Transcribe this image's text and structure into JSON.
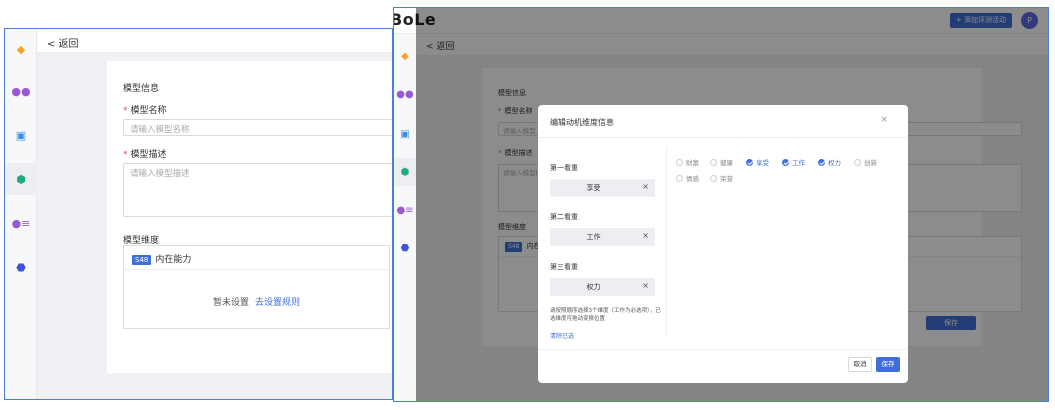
{
  "left": {
    "back_label": "< 返回",
    "section_info": "模型信息",
    "name_label": "模型名称",
    "name_placeholder": "请输入模型名称",
    "desc_label": "模型描述",
    "desc_placeholder": "请输入模型描述",
    "section_dimension": "模型维度",
    "dimension_badge": "S48",
    "dimension_name": "内在能力",
    "empty_text": "暂未设置",
    "set_rule_link": "去设置规则"
  },
  "right": {
    "logo": "BoLe",
    "add_button": "+ 添加评测活动",
    "avatar_letter": "P",
    "back_label": "< 返回",
    "section_info": "模型信息",
    "name_label": "模型名称",
    "name_placeholder": "请输入模型",
    "desc_label": "模型描述",
    "desc_placeholder": "请输入模型描",
    "section_dimension": "模型维度",
    "dimension_badge": "S48",
    "dimension_name": "内在",
    "save_bg_button": "保存"
  },
  "modal": {
    "title": "编辑动机维度信息",
    "close": "×",
    "priorities": [
      {
        "label": "第一看重",
        "value": "享受"
      },
      {
        "label": "第二看重",
        "value": "工作"
      },
      {
        "label": "第三看重",
        "value": "权力"
      }
    ],
    "hint": "请按照顺序选择3个维度（工作为必选项），已选维度可拖动变换位置",
    "clear_link": "清除已选",
    "options": [
      {
        "label": "财富",
        "checked": false
      },
      {
        "label": "健康",
        "checked": false
      },
      {
        "label": "享受",
        "checked": true
      },
      {
        "label": "工作",
        "checked": true
      },
      {
        "label": "权力",
        "checked": true
      },
      {
        "label": "创新",
        "checked": false
      },
      {
        "label": "情感",
        "checked": false
      },
      {
        "label": "荣誉",
        "checked": false
      }
    ],
    "cancel_button": "取消",
    "save_button": "保存"
  },
  "colors": {
    "accent": "#3f6fd8",
    "required": "#e34d4d"
  }
}
